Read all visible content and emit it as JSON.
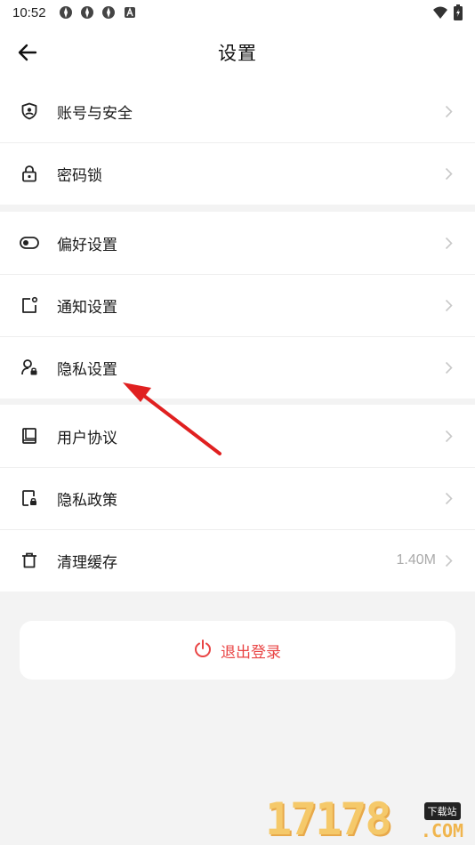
{
  "status_bar": {
    "time": "10:52",
    "left_icons": [
      "app-notification-icon",
      "app-notification-icon",
      "app-notification-icon",
      "a-badge-icon"
    ],
    "right_icons": [
      "wifi-icon",
      "battery-icon"
    ]
  },
  "header": {
    "title": "设置"
  },
  "groups": [
    {
      "items": [
        {
          "label": "账号与安全",
          "icon": "shield-user-icon"
        },
        {
          "label": "密码锁",
          "icon": "lock-icon"
        }
      ]
    },
    {
      "items": [
        {
          "label": "偏好设置",
          "icon": "toggle-icon"
        },
        {
          "label": "通知设置",
          "icon": "notification-icon"
        },
        {
          "label": "隐私设置",
          "icon": "privacy-user-icon"
        }
      ]
    },
    {
      "items": [
        {
          "label": "用户协议",
          "icon": "book-icon"
        },
        {
          "label": "隐私政策",
          "icon": "document-lock-icon"
        },
        {
          "label": "清理缓存",
          "icon": "trash-icon",
          "value": "1.40M"
        }
      ]
    }
  ],
  "logout": {
    "label": "退出登录",
    "icon": "power-icon",
    "color": "#e94545"
  },
  "annotation": {
    "arrow_color": "#e02020"
  },
  "watermark": {
    "digits": "17178",
    "badge": "下载站",
    "suffix": ".COM"
  },
  "colors": {
    "background": "#f3f3f3",
    "surface": "#ffffff",
    "text": "#1a1a1a",
    "muted": "#aaaaaa"
  }
}
